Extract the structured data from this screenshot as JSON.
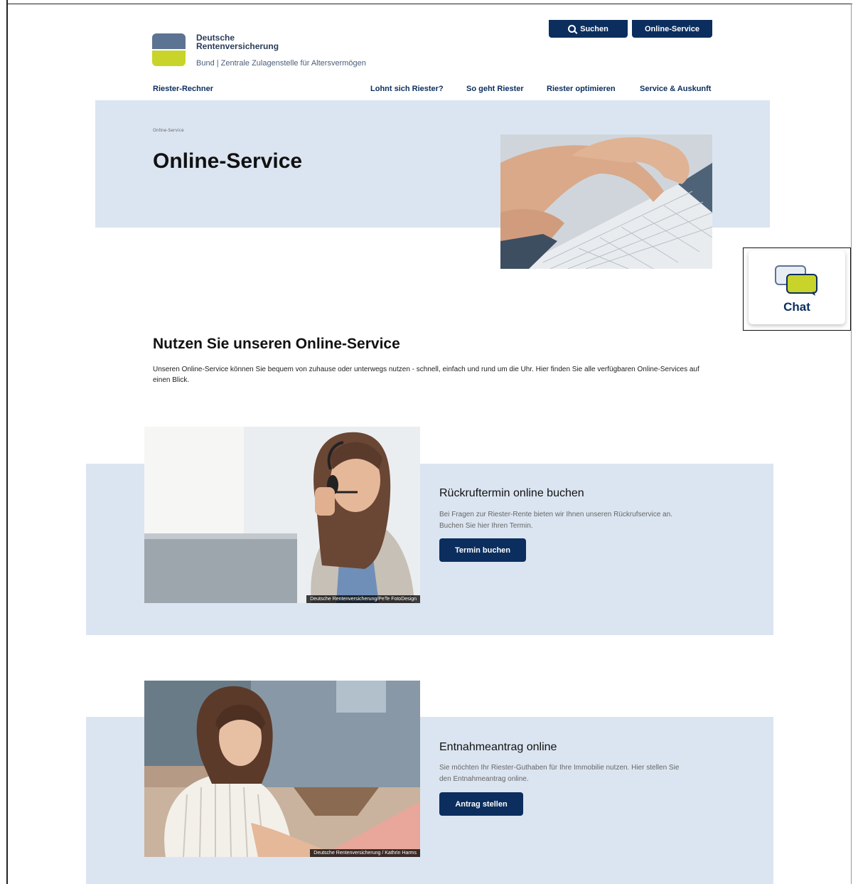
{
  "logo": {
    "name_line1": "Deutsche",
    "name_line2": "Rentenversicherung",
    "subtitle": "Bund  |  Zentrale Zulagenstelle für Altersvermögen"
  },
  "header": {
    "search_label": "Suchen",
    "online_service_label": "Online-Service"
  },
  "nav": {
    "items": [
      {
        "label": "Riester-Rechner"
      },
      {
        "label": "Lohnt sich Riester?"
      },
      {
        "label": "So geht Riester"
      },
      {
        "label": "Riester optimieren"
      },
      {
        "label": "Service & Auskunft"
      }
    ]
  },
  "hero": {
    "breadcrumb": "Online-Service",
    "title": "Online-Service"
  },
  "chat": {
    "label": "Chat"
  },
  "intro": {
    "title": "Nutzen Sie unseren Online-Service",
    "text": "Unseren Online-Service können Sie bequem von zuhause oder unterwegs nutzen - schnell, einfach und rund um die Uhr. Hier finden Sie alle verfügbaren Online-Services auf einen Blick."
  },
  "cards": [
    {
      "title": "Rückruftermin online buchen",
      "text": "Bei Fragen zur Riester-Rente bieten wir Ihnen unseren Rückrufservice an. Buchen Sie hier Ihren Termin.",
      "button": "Termin buchen",
      "credit": "Deutsche Rentenversicherung/PeTe FotoDesign"
    },
    {
      "title": "Entnahmeantrag online",
      "text": "Sie möchten Ihr Riester-Guthaben für Ihre Immobilie nutzen. Hier stellen Sie den Entnahmeantrag online.",
      "button": "Antrag stellen",
      "credit": "Deutsche Rentenversicherung / Kathrin Harms"
    }
  ],
  "colors": {
    "brand_navy": "#0b2e5e",
    "brand_slate": "#5d7393",
    "brand_lime": "#c8d42a",
    "panel_blue": "#dbe5f1"
  }
}
